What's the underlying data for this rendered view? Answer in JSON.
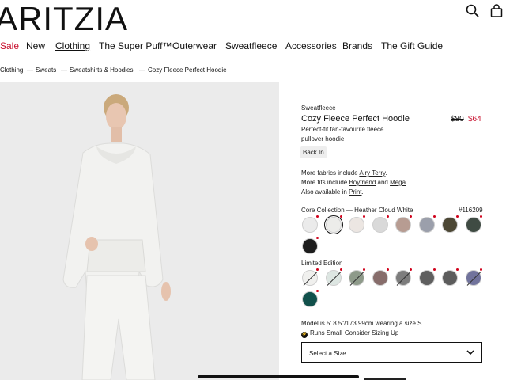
{
  "brand": {
    "logo": "ARITZIA"
  },
  "nav": {
    "items": [
      {
        "label": "Sale",
        "sale": true
      },
      {
        "label": "New"
      },
      {
        "label": "Clothing",
        "active": true
      },
      {
        "label": "The Super Puff™"
      },
      {
        "label": "Outerwear"
      },
      {
        "label": "Sweatfleece"
      },
      {
        "label": "Accessories"
      },
      {
        "label": "Brands"
      },
      {
        "label": "The Gift Guide"
      }
    ]
  },
  "breadcrumb": {
    "items": [
      "Clothing",
      "Sweats",
      "Sweatshirts & Hoodies",
      "Cozy Fleece Perfect Hoodie"
    ],
    "separator": "—"
  },
  "product": {
    "category": "Sweatfleece",
    "name": "Cozy Fleece Perfect Hoodie",
    "price_original": "$80",
    "price_sale": "$64",
    "description": "Perfect-fit fan-favourite fleece pullover hoodie",
    "badge": "Back In",
    "more_fabrics_prefix": "More fabrics include ",
    "more_fabrics_link": "Airy Terry",
    "more_fabrics_suffix": ".",
    "more_fits_prefix": "More fits include ",
    "more_fits_link1": "Boyfriend",
    "more_fits_and": " and ",
    "more_fits_link2": "Mega",
    "more_fits_suffix": ".",
    "also_prefix": "Also available in ",
    "also_link": "Print",
    "also_suffix": "."
  },
  "core_collection": {
    "title": "Core Collection — Heather Cloud White",
    "style_number": "#116209",
    "swatches": [
      {
        "color": "#ebebeb",
        "selected": false,
        "dot": true
      },
      {
        "color": "#ececea",
        "selected": true,
        "dot": true
      },
      {
        "color": "#ece6e2",
        "selected": false,
        "dot": true
      },
      {
        "color": "#d9d9d9",
        "selected": false,
        "dot": true
      },
      {
        "color": "#b79c92",
        "selected": false,
        "dot": true
      },
      {
        "color": "#9b9fab",
        "selected": false,
        "dot": true
      },
      {
        "color": "#4c4734",
        "selected": false,
        "dot": true
      },
      {
        "color": "#3f4b43",
        "selected": false,
        "dot": true
      },
      {
        "color": "#1d1d1d",
        "selected": false,
        "dot": true
      }
    ]
  },
  "limited_edition": {
    "title": "Limited Edition",
    "swatches": [
      {
        "color": "#f0f0ee",
        "slash": true
      },
      {
        "color": "#dde6e2",
        "slash": true
      },
      {
        "color": "#8e9a8a",
        "slash": true
      },
      {
        "color": "#876d6b",
        "slash": false
      },
      {
        "color": "#7d7d7d",
        "slash": true
      },
      {
        "color": "#5f5f5f",
        "slash": false
      },
      {
        "color": "#5c5c5c",
        "slash": false
      },
      {
        "color": "#71739c",
        "slash": true
      },
      {
        "color": "#11504b",
        "slash": false
      }
    ]
  },
  "model_info": "Model is 5' 8.5\"/173.99cm wearing a size S",
  "fit": {
    "label": "Runs Small",
    "link": "Consider Sizing Up"
  },
  "size_select": {
    "placeholder": "Select a Size"
  },
  "icons": [
    "search-icon",
    "bag-icon",
    "chevron-down-icon",
    "lightning-icon"
  ],
  "colors": {
    "sale_red": "#c8102e",
    "text": "#111111",
    "hero_bg": "#ececec"
  }
}
